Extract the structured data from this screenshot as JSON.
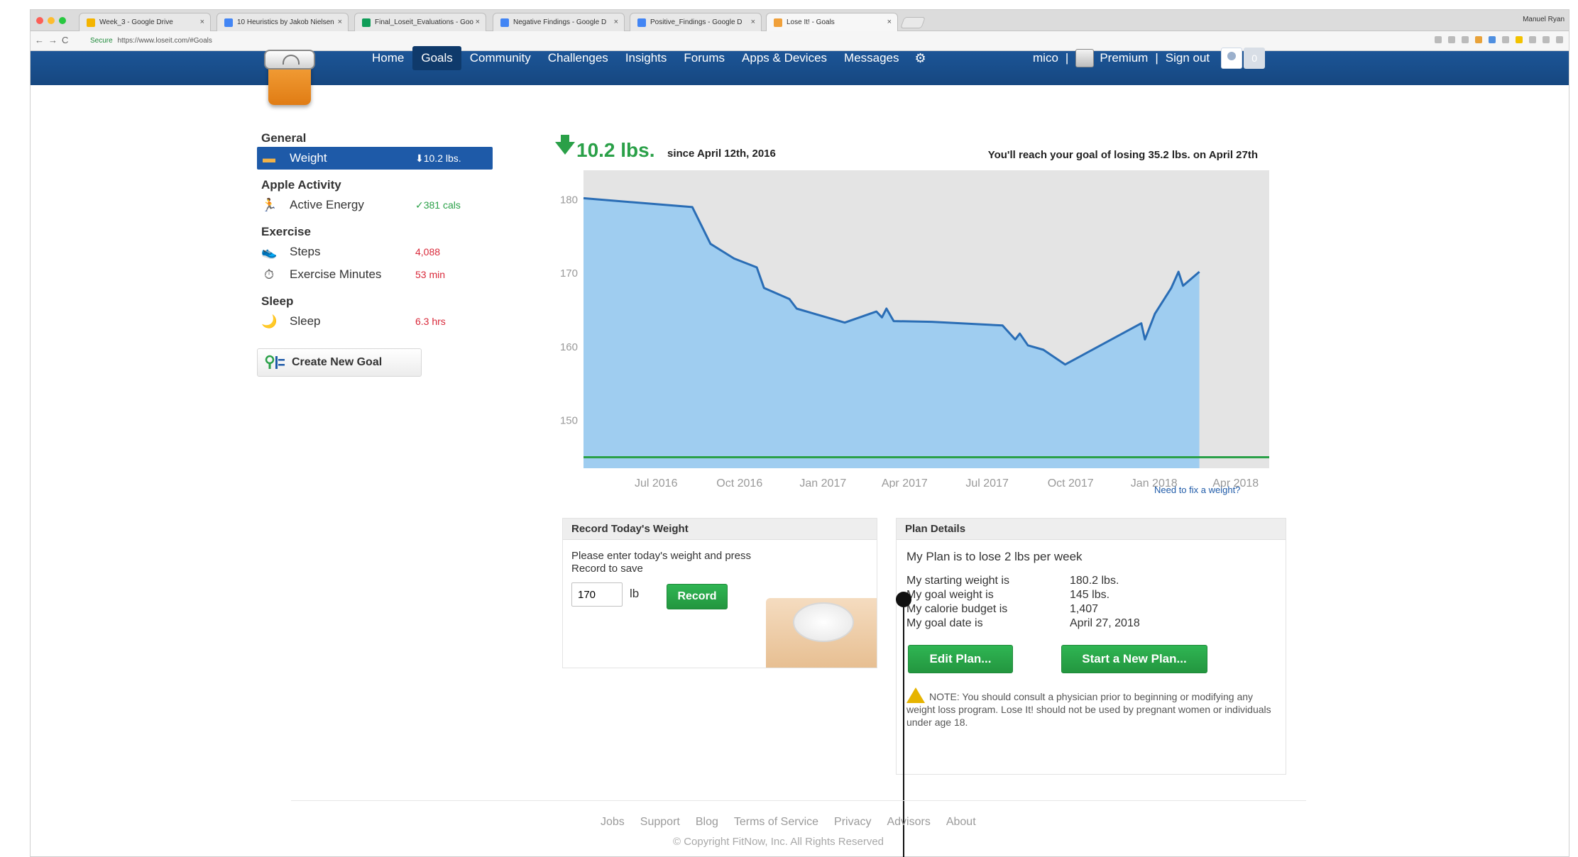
{
  "browser": {
    "tabs": [
      {
        "label": "Week_3 - Google Drive",
        "color": "#f4b400"
      },
      {
        "label": "10 Heuristics by Jakob Nielsen",
        "color": "#4285f4"
      },
      {
        "label": "Final_Loseit_Evaluations - Goo",
        "color": "#0f9d58"
      },
      {
        "label": "Negative Findings - Google D",
        "color": "#4285f4"
      },
      {
        "label": "Positive_Findings - Google D",
        "color": "#4285f4"
      },
      {
        "label": "Lose It! - Goals",
        "color": "#f0a03a"
      }
    ],
    "profile": "Manuel Ryan",
    "url_secure": "Secure",
    "url": "https://www.loseit.com/#Goals"
  },
  "nav": {
    "links": [
      "Home",
      "Goals",
      "Community",
      "Challenges",
      "Insights",
      "Forums",
      "Apps & Devices",
      "Messages"
    ],
    "active": "Goals",
    "username": "mico",
    "premium": "Premium",
    "signout": "Sign out",
    "notif_count": "0",
    "sep": "|"
  },
  "sidebar": {
    "sections": [
      {
        "header": "General",
        "items": [
          {
            "label": "Weight",
            "value": "⬇10.2 lbs.",
            "icon": "weight-icon",
            "selected": true,
            "tone": "white"
          }
        ]
      },
      {
        "header": "Apple Activity",
        "items": [
          {
            "label": "Active Energy",
            "value": "✓381 cals",
            "icon": "runner-icon",
            "tone": "green"
          }
        ]
      },
      {
        "header": "Exercise",
        "items": [
          {
            "label": "Steps",
            "value": "4,088",
            "icon": "shoes-icon",
            "tone": "red"
          },
          {
            "label": "Exercise Minutes",
            "value": "53 min",
            "icon": "stopwatch-icon",
            "tone": "red"
          }
        ]
      },
      {
        "header": "Sleep",
        "items": [
          {
            "label": "Sleep",
            "value": "6.3 hrs",
            "icon": "moon-icon",
            "tone": "red"
          }
        ]
      }
    ],
    "create_goal": "Create New Goal"
  },
  "summary": {
    "change": "10.2 lbs.",
    "since": "since April 12th, 2016",
    "goal_text": "You'll reach your goal of losing 35.2 lbs. on April 27th"
  },
  "chart_data": {
    "type": "area",
    "x_tick_labels": [
      "Jul 2016",
      "Oct 2016",
      "Jan 2017",
      "Apr 2017",
      "Jul 2017",
      "Oct 2017",
      "Jan 2018",
      "Apr 2018"
    ],
    "y_ticks": [
      180,
      170,
      160,
      150
    ],
    "ylim": [
      143.5,
      184
    ],
    "xlim": [
      "2016-04-12",
      "2018-05-08"
    ],
    "series": [
      {
        "values": [
          {
            "x": "2016-04-12",
            "y": 180.2
          },
          {
            "x": "2016-08-10",
            "y": 179.0
          },
          {
            "x": "2016-08-30",
            "y": 174.0
          },
          {
            "x": "2016-09-25",
            "y": 172.0
          },
          {
            "x": "2016-10-20",
            "y": 170.8
          },
          {
            "x": "2016-10-28",
            "y": 168.0
          },
          {
            "x": "2016-11-25",
            "y": 166.5
          },
          {
            "x": "2016-12-03",
            "y": 165.2
          },
          {
            "x": "2017-01-25",
            "y": 163.3
          },
          {
            "x": "2017-03-01",
            "y": 164.8
          },
          {
            "x": "2017-03-07",
            "y": 164.0
          },
          {
            "x": "2017-03-12",
            "y": 165.2
          },
          {
            "x": "2017-03-20",
            "y": 163.5
          },
          {
            "x": "2017-05-01",
            "y": 163.4
          },
          {
            "x": "2017-07-18",
            "y": 162.9
          },
          {
            "x": "2017-08-01",
            "y": 161.0
          },
          {
            "x": "2017-08-06",
            "y": 161.8
          },
          {
            "x": "2017-08-15",
            "y": 160.2
          },
          {
            "x": "2017-09-01",
            "y": 159.6
          },
          {
            "x": "2017-09-25",
            "y": 157.6
          },
          {
            "x": "2017-12-18",
            "y": 163.2
          },
          {
            "x": "2017-12-22",
            "y": 161.0
          },
          {
            "x": "2018-01-02",
            "y": 164.5
          },
          {
            "x": "2018-01-20",
            "y": 168.0
          },
          {
            "x": "2018-01-28",
            "y": 170.2
          },
          {
            "x": "2018-02-02",
            "y": 168.3
          },
          {
            "x": "2018-02-20",
            "y": 170.2
          }
        ]
      }
    ],
    "goal_line": 145,
    "shaded_future_from": "2018-02-20",
    "colors": {
      "fill": "#9fcdf0",
      "line": "#2a6db5",
      "goal": "#2aa048",
      "bg": "#e4e4e4"
    }
  },
  "fix_link": "Need to fix a weight?",
  "record": {
    "title": "Record Today's Weight",
    "instructions": "Please enter today's weight and press Record to save",
    "value": "170",
    "unit": "lb",
    "button": "Record"
  },
  "plan": {
    "title": "Plan Details",
    "summary": "My Plan is to lose 2 lbs per week",
    "rows": [
      {
        "label": "My starting weight is",
        "value": "180.2 lbs."
      },
      {
        "label": "My goal weight is",
        "value": "145 lbs."
      },
      {
        "label": "My calorie budget is",
        "value": "1,407"
      },
      {
        "label": "My goal date is",
        "value": "April 27, 2018"
      }
    ],
    "edit_button": "Edit Plan...",
    "start_button": "Start a New Plan...",
    "note": "NOTE: You should consult a physician prior to beginning or modifying any weight loss program. Lose It! should not be used by pregnant women or individuals under age 18."
  },
  "footer": {
    "links": [
      "Jobs",
      "Support",
      "Blog",
      "Terms of Service",
      "Privacy",
      "Advisors",
      "About"
    ],
    "copyright": "© Copyright FitNow, Inc. All Rights Reserved"
  }
}
